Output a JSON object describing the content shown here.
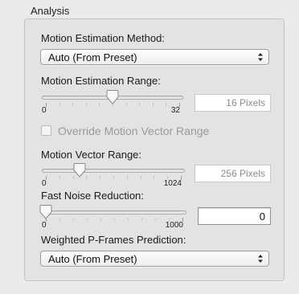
{
  "group": {
    "title": "Analysis"
  },
  "motion_estimation_method": {
    "label": "Motion Estimation Method:",
    "selected": "Auto (From Preset)"
  },
  "motion_estimation_range": {
    "label": "Motion Estimation Range:",
    "min_label": "0",
    "max_label": "32",
    "min": 0,
    "max": 32,
    "value": 16,
    "readout": "16 Pixels"
  },
  "override_motion_vector_range": {
    "label": "Override Motion Vector Range",
    "checked": false,
    "enabled": false
  },
  "motion_vector_range": {
    "label": "Motion Vector Range:",
    "min_label": "0",
    "max_label": "1024",
    "min": 0,
    "max": 1024,
    "value": 256,
    "readout": "256 Pixels"
  },
  "fast_noise_reduction": {
    "label": "Fast Noise Reduction:",
    "min_label": "0",
    "max_label": "1000",
    "min": 0,
    "max": 1000,
    "value": 0,
    "field_value": "0"
  },
  "weighted_p_frames_prediction": {
    "label": "Weighted P-Frames Prediction:",
    "selected": "Auto (From Preset)"
  }
}
